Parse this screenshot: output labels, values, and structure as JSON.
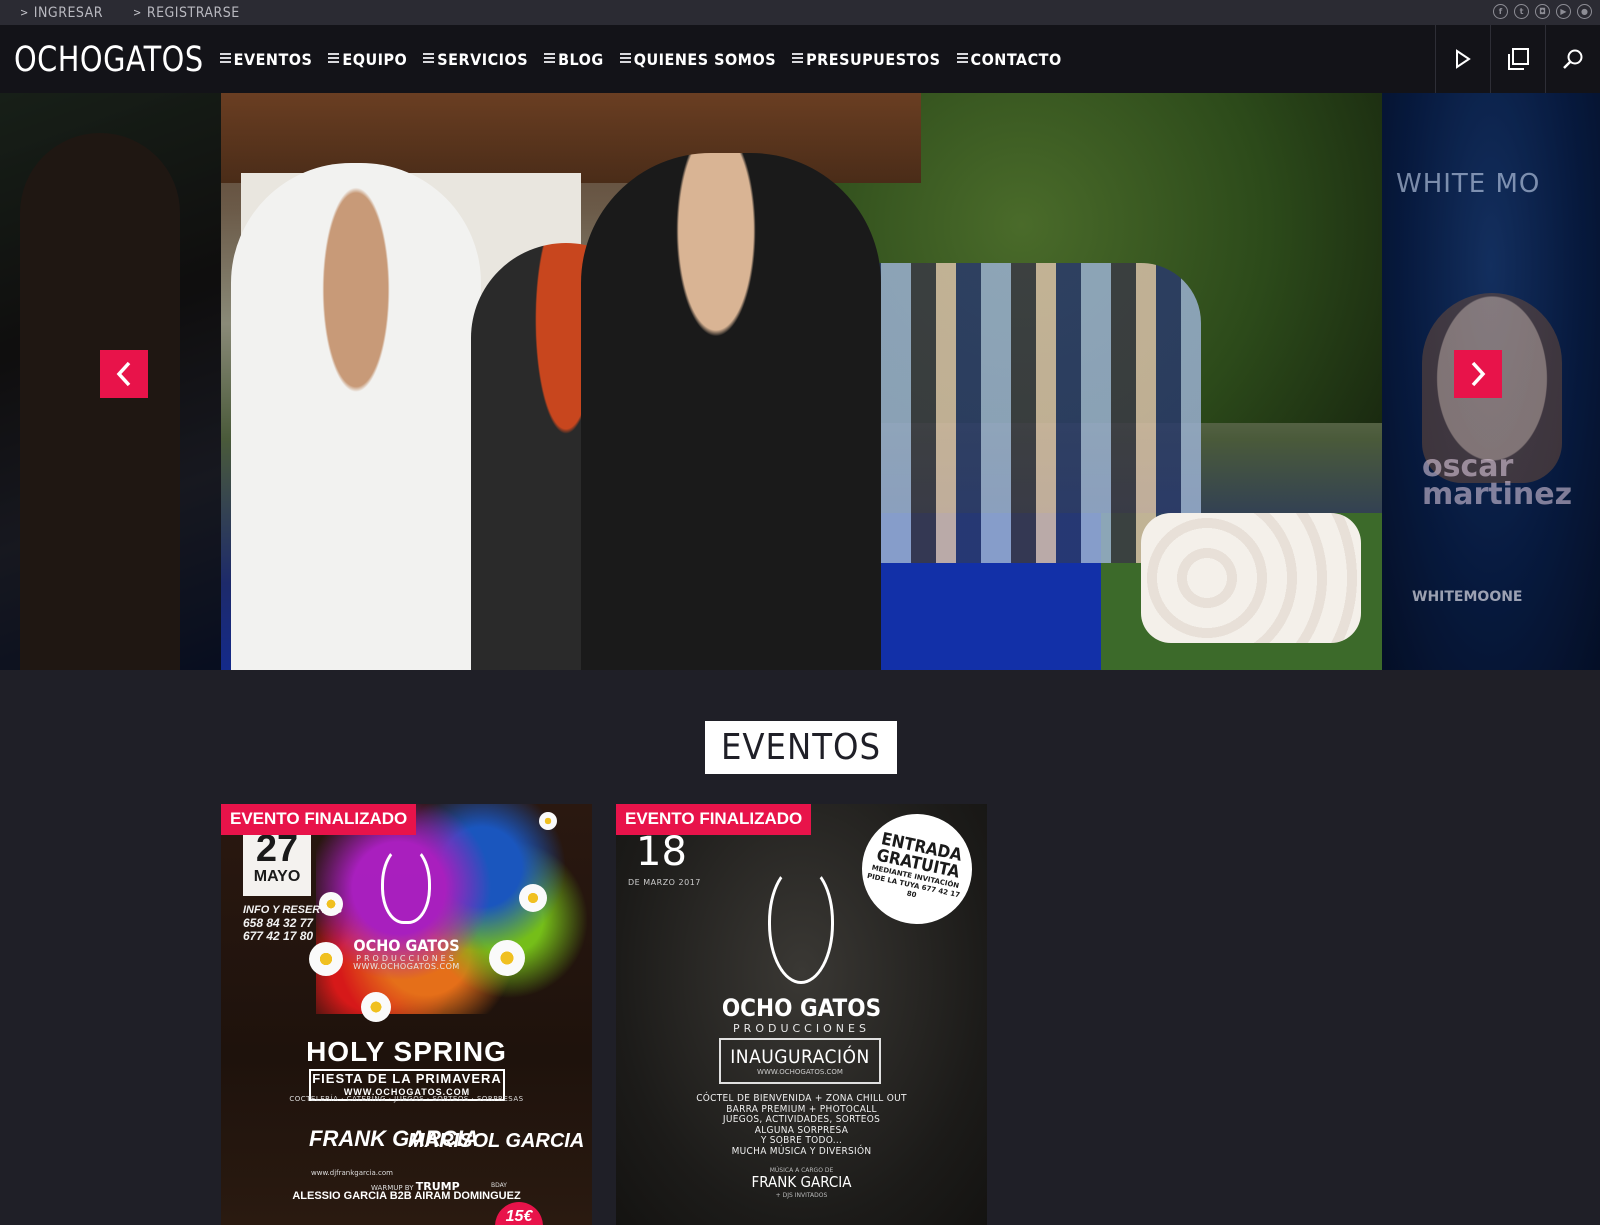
{
  "topbar": {
    "links": [
      {
        "label": "INGRESAR"
      },
      {
        "label": "REGISTRARSE"
      }
    ],
    "social_icons": [
      "facebook-icon",
      "twitter-icon",
      "instagram-icon",
      "youtube-icon",
      "flickr-icon"
    ]
  },
  "nav": {
    "logo": "OCHOGATOS",
    "items": [
      {
        "label": "EVENTOS"
      },
      {
        "label": "EQUIPO"
      },
      {
        "label": "SERVICIOS"
      },
      {
        "label": "BLOG"
      },
      {
        "label": "QUIENES SOMOS"
      },
      {
        "label": "PRESUPUESTOS"
      },
      {
        "label": "CONTACTO"
      }
    ],
    "actions": [
      "play-icon",
      "copy-icon",
      "search-icon"
    ]
  },
  "slider": {
    "right_slide": {
      "brand": "WHITE MO",
      "artist": "oscar martinez",
      "handle": "WHITEMOONE"
    },
    "accent": "#e8134a"
  },
  "events_section": {
    "title": "EVENTOS",
    "cards": [
      {
        "badge": "EVENTO FINALIZADO",
        "date_day": "27",
        "date_month": "MAYO",
        "info_label": "INFO Y RESERVAS",
        "phone1": "658 84 32 77",
        "phone2": "677 42 17 80",
        "brand": "OCHO GATOS",
        "brand_sub": "PRODUCCIONES",
        "brand_url": "WWW.OCHOGATOS.COM",
        "name": "HOLY SPRING",
        "subtitle": "FIESTA DE LA PRIMAVERA",
        "subtitle_url": "WWW.OCHOGATOS.COM",
        "tagline": "COCTELERÍA · CATERING · JUEGOS · SORTEOS · SORPRESAS",
        "dj1": "FRANK GARCIA",
        "dj1_url": "www.djfrankgarcia.com",
        "dj2": "MARISOL GARCIA",
        "warmup_label": "WARMUP BY",
        "warmup_name": "TRUMP",
        "bday": "BDAY",
        "lineup": "ALESSIO GARCIA B2B AIRAM DOMINGUEZ",
        "price": "15€"
      },
      {
        "badge": "EVENTO FINALIZADO",
        "date_day": "18",
        "date_month": "DE MARZO 2017",
        "entrada_title": "ENTRADA GRATUITA",
        "entrada_sub": "MEDIANTE INVITACIÓN PIDE LA TUYA 677 42 17 80",
        "brand": "OCHO GATOS",
        "brand_sub": "PRODUCCIONES",
        "name": "INAUGURACIÓN",
        "name_url": "WWW.OCHOGATOS.COM",
        "details": [
          "CÓCTEL DE BIENVENIDA + ZONA CHILL OUT",
          "BARRA PREMIUM + PHOTOCALL",
          "JUEGOS, ACTIVIDADES, SORTEOS",
          "ALGUNA SORPRESA",
          "Y SOBRE TODO...",
          "MUCHA MÚSICA Y DIVERSIÓN"
        ],
        "music_label": "MÚSICA A CARGO DE",
        "dj": "FRANK GARCIA",
        "dj_guests": "+ DJS INVITADOS"
      }
    ]
  }
}
